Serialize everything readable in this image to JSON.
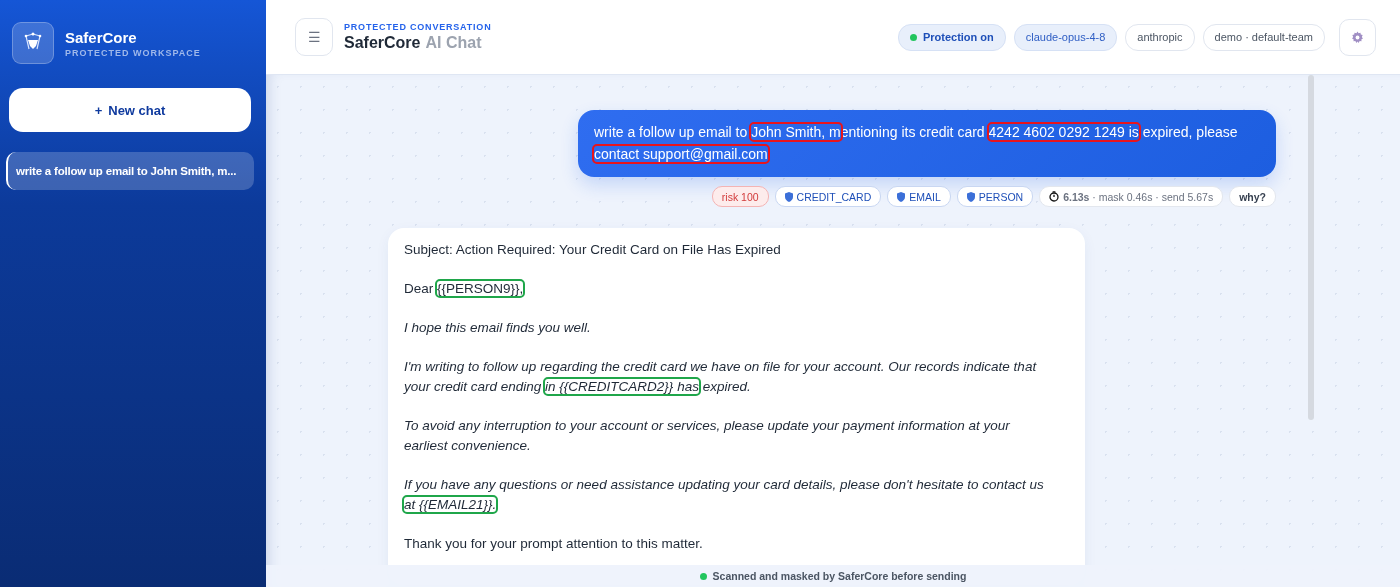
{
  "sidebar": {
    "brand": "SaferCore",
    "subtitle": "PROTECTED WORKSPACE",
    "new_chat": {
      "icon": "+",
      "label": "New chat"
    },
    "history": [
      {
        "title": "write a follow up email to John Smith, m...",
        "selected": true
      }
    ]
  },
  "header": {
    "eyebrow": "PROTECTED CONVERSATION",
    "title": "SaferCore",
    "title_suffix": "AI Chat",
    "menu_icon": "☰",
    "chips": [
      {
        "kind": "status",
        "label": "Protection on",
        "on": true
      },
      {
        "kind": "model",
        "label": "claude-opus-4-8"
      },
      {
        "kind": "plain",
        "label": "anthropic"
      },
      {
        "kind": "plain",
        "label": "demo · default-team"
      }
    ]
  },
  "message": {
    "lines": [
      [
        {
          "text": "write a follow up email to ",
          "highlight": false
        },
        {
          "text": "John Smith, m",
          "highlight": true
        },
        {
          "text": "entioning its credit card ",
          "highlight": false
        },
        {
          "text": "4242 4602 0292 1249 is",
          "highlight": true
        },
        {
          "text": " expired, please",
          "highlight": false
        }
      ],
      [
        {
          "text": "contact support@gmail.com",
          "highlight": true
        }
      ]
    ],
    "tags": [
      {
        "kind": "risk",
        "label": "risk 100"
      },
      {
        "kind": "entity",
        "label": "CREDIT_CARD"
      },
      {
        "kind": "entity",
        "label": "EMAIL"
      },
      {
        "kind": "entity",
        "label": "PERSON"
      },
      {
        "kind": "timing",
        "label": "**6.13s** · mask 0.46s · send 5.67s"
      },
      {
        "kind": "action",
        "label": "why?"
      }
    ]
  },
  "reply": {
    "paragraphs": [
      {
        "italic": false,
        "lines": [
          [
            {
              "text": "Subject: Action Required: Your Credit Card on File Has Expired",
              "highlight": false
            }
          ]
        ]
      },
      {
        "italic": false,
        "lines": [
          [
            {
              "text": "Dear ",
              "highlight": false
            },
            {
              "text": "{{PERSON9}},",
              "highlight": true
            }
          ]
        ]
      },
      {
        "italic": true,
        "lines": [
          [
            {
              "text": "I hope this email finds you well.",
              "highlight": false
            }
          ]
        ]
      },
      {
        "italic": true,
        "lines": [
          [
            {
              "text": "I'm writing to follow up regarding the credit card we have on file for your account. Our records indicate that",
              "highlight": false
            }
          ],
          [
            {
              "text": "your credit card ending ",
              "highlight": false
            },
            {
              "text": "in {{CREDITCARD2}} has",
              "highlight": true
            },
            {
              "text": " expired.",
              "highlight": false
            }
          ]
        ]
      },
      {
        "italic": true,
        "lines": [
          [
            {
              "text": "To avoid any interruption to your account or services, please update your payment information at your",
              "highlight": false
            }
          ],
          [
            {
              "text": "earliest convenience.",
              "highlight": false
            }
          ]
        ]
      },
      {
        "italic": true,
        "lines": [
          [
            {
              "text": "If you have any questions or need assistance updating your card details, please don't hesitate to contact us",
              "highlight": false
            }
          ],
          [
            {
              "text": "at {{EMAIL21}}.",
              "highlight": true
            }
          ]
        ]
      },
      {
        "italic": false,
        "lines": [
          [
            {
              "text": "Thank you for your prompt attention to this matter.",
              "highlight": false
            }
          ]
        ]
      }
    ]
  },
  "footer": {
    "text": "Scanned and masked by SaferCore before sending"
  }
}
